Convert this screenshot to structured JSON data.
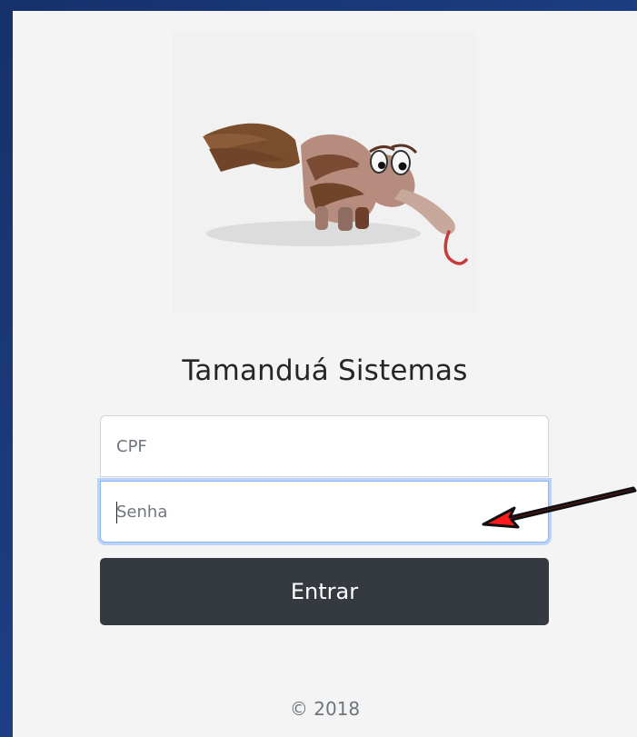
{
  "window": {
    "background_colors": [
      "#16316b",
      "#233f8c"
    ]
  },
  "logo": {
    "icon": "anteater-icon"
  },
  "brand": {
    "title": "Tamanduá Sistemas"
  },
  "form": {
    "cpf_placeholder": "CPF",
    "password_placeholder": "Senha",
    "submit_label": "Entrar"
  },
  "footer": {
    "copyright": "© 2018"
  },
  "annotation": {
    "color": "#e00000",
    "icon": "red-arrow-icon"
  }
}
